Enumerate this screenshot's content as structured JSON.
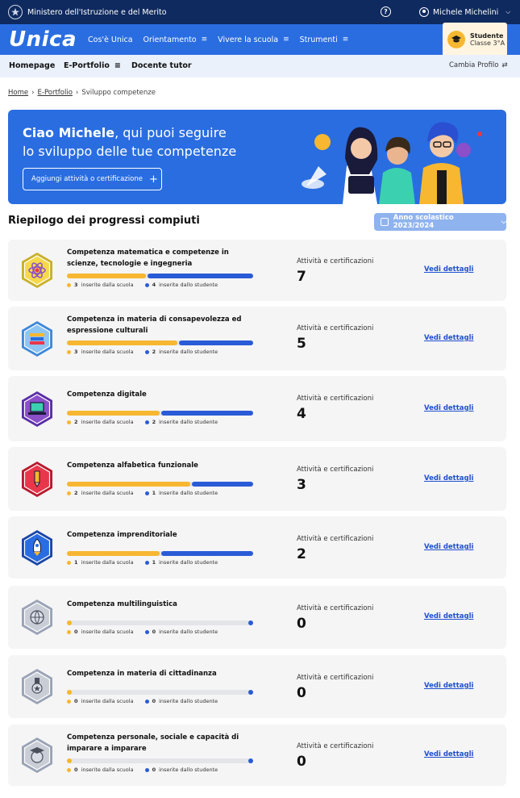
{
  "govbar": {
    "ministry": "Ministero dell'Istruzione e del Merito",
    "help": "?",
    "user_name": "Michele Michelini"
  },
  "brand": {
    "logo": "Unica"
  },
  "mainnav": [
    {
      "label": "Cos'è Unica",
      "menu": false
    },
    {
      "label": "Orientamento",
      "menu": true
    },
    {
      "label": "Vivere la scuola",
      "menu": true
    },
    {
      "label": "Strumenti",
      "menu": true
    }
  ],
  "profile": {
    "role": "Studente",
    "class": "Classe 3°A"
  },
  "subnav": {
    "homepage": "Homepage",
    "eportfolio": "E-Portfolio",
    "tutor": "Docente tutor",
    "switch_profile": "Cambia Profilo"
  },
  "breadcrumb": {
    "home": "Home",
    "eportfolio": "E-Portfolio",
    "current": "Sviluppo competenze",
    "sep": "›"
  },
  "hero": {
    "greeting_bold": "Ciao Michele",
    "greeting_rest": ", qui puoi seguire",
    "line2": "lo sviluppo delle tue competenze",
    "add_button": "Aggiungi attività o certificazione",
    "add_icon": "+"
  },
  "summary": {
    "title": "Riepilogo dei progressi compiuti",
    "year": "Anno scolastico 2023/2024"
  },
  "labels": {
    "activities": "Attività e certificazioni",
    "details": "Vedi dettagli",
    "school_suffix": "inserite dalla scuola",
    "student_suffix": "inserite dallo studente"
  },
  "colors": {
    "school": "#f7b731",
    "student": "#2a5bd7",
    "accent": "#2a6de0",
    "navy": "#0f2a5f"
  },
  "competences": [
    {
      "title": "Competenza matematica e competenze in scienze, tecnologie e ingegneria",
      "school": 3,
      "student": 4,
      "total": 7,
      "icon": "atom-icon",
      "badge_color": "#f6d94a"
    },
    {
      "title": "Competenza in materia di consapevolezza ed espressione culturali",
      "school": 3,
      "student": 2,
      "total": 5,
      "icon": "books-icon",
      "badge_color": "#8ec5f2"
    },
    {
      "title": "Competenza digitale",
      "school": 2,
      "student": 2,
      "total": 4,
      "icon": "laptop-icon",
      "badge_color": "#8b4fc9"
    },
    {
      "title": "Competenza alfabetica funzionale",
      "school": 2,
      "student": 1,
      "total": 3,
      "icon": "pencil-icon",
      "badge_color": "#e8374b"
    },
    {
      "title": "Competenza imprenditoriale",
      "school": 1,
      "student": 1,
      "total": 2,
      "icon": "rocket-icon",
      "badge_color": "#2a6de0"
    },
    {
      "title": "Competenza multilinguistica",
      "school": 0,
      "student": 0,
      "total": 0,
      "icon": "globe-icon",
      "badge_color": "#b8bcc8"
    },
    {
      "title": "Competenza in materia di cittadinanza",
      "school": 0,
      "student": 0,
      "total": 0,
      "icon": "medal-icon",
      "badge_color": "#b8bcc8"
    },
    {
      "title": "Competenza personale, sociale e capacità di imparare a imparare",
      "school": 0,
      "student": 0,
      "total": 0,
      "icon": "graduate-icon",
      "badge_color": "#b8bcc8"
    }
  ]
}
